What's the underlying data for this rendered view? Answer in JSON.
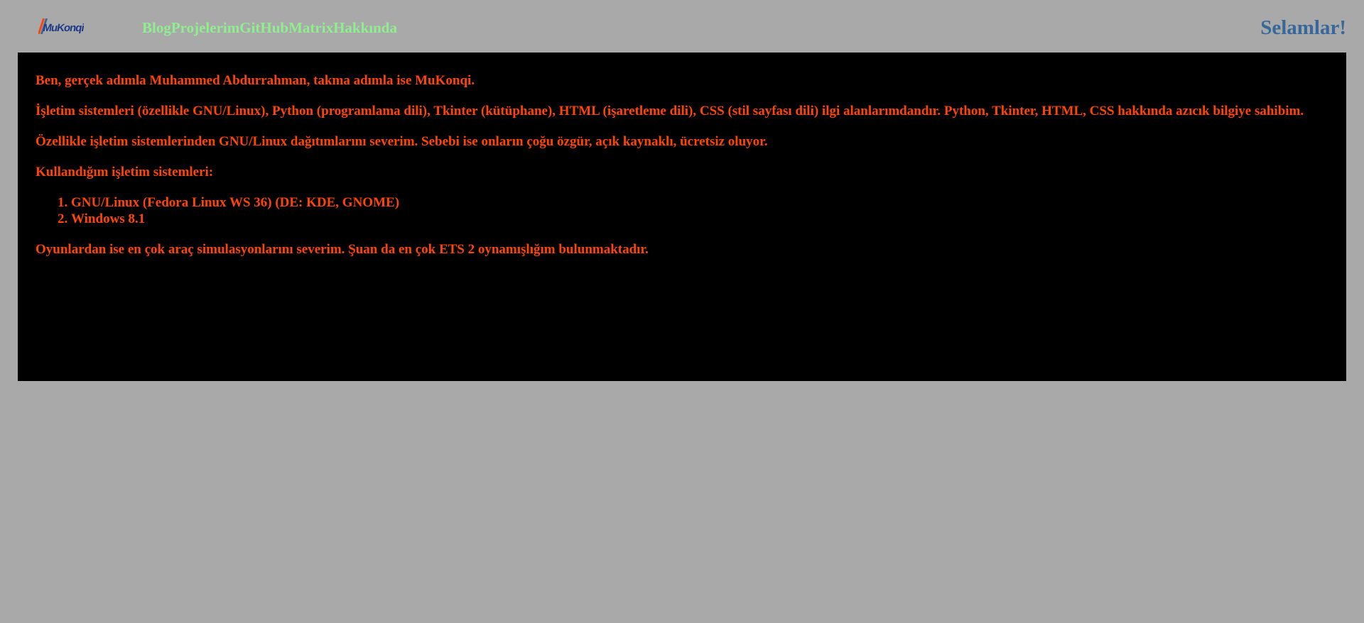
{
  "header": {
    "logo_text": "MuKonqi",
    "nav": [
      {
        "label": "Blog"
      },
      {
        "label": "Projelerim"
      },
      {
        "label": "GitHub"
      },
      {
        "label": "Matrix"
      },
      {
        "label": "Hakkında"
      }
    ],
    "greeting": "Selamlar!"
  },
  "content": {
    "intro": "Ben, gerçek adımla Muhammed Abdurrahman, takma adımla ise MuKonqi.",
    "interests": "İşletim sistemleri (özellikle GNU/Linux), Python (programlama dili), Tkinter (kütüphane), HTML (işaretleme dili), CSS (stil sayfası dili) ilgi alanlarımdandır. Python, Tkinter, HTML, CSS hakkında azıcık bilgiye sahibim.",
    "linux_pref": "Özellikle işletim sistemlerinden GNU/Linux dağıtımlarını severim. Sebebi ise onların çoğu özgür, açık kaynaklı, ücretsiz oluyor.",
    "os_heading": "Kullandığım işletim sistemleri:",
    "os_list": [
      "GNU/Linux (Fedora Linux WS 36) (DE: KDE, GNOME)",
      "Windows 8.1"
    ],
    "games": "Oyunlardan ise en çok araç simulasyonlarını severim. Şuan da en çok ETS 2 oynamışlığım bulunmaktadır."
  },
  "colors": {
    "page_background": "#a9a9a9",
    "panel_background": "#000000",
    "body_text": "#ff4500",
    "nav_link": "#90ee90",
    "greeting": "#38679c"
  }
}
